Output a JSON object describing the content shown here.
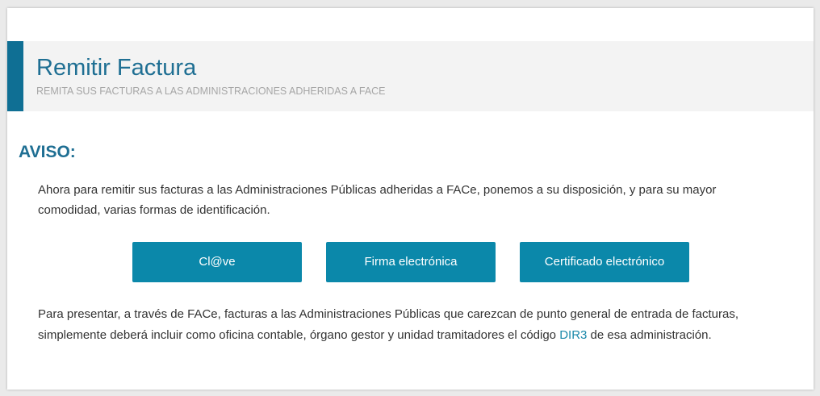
{
  "header": {
    "title": "Remitir Factura",
    "subtitle": "REMITA SUS FACTURAS A LAS ADMINISTRACIONES ADHERIDAS A FACE",
    "accent_color": "#0f6f94"
  },
  "notice": {
    "heading": "AVISO:",
    "intro": "Ahora para remitir sus facturas a las Administraciones Públicas adheridas a FACe, ponemos a su disposición, y para su mayor comodidad, varias formas de identificación.",
    "note_before": "Para presentar, a través de FACe, facturas a las Administraciones Públicas que carezcan de punto general de entrada de facturas, simplemente deberá incluir como oficina contable, órgano gestor y unidad tramitadores el código ",
    "note_link": "DIR3",
    "note_after": " de esa administración."
  },
  "buttons": {
    "clave": "Cl@ve",
    "firma": "Firma electrónica",
    "certificado": "Certificado electrónico",
    "color": "#0b88aa"
  }
}
